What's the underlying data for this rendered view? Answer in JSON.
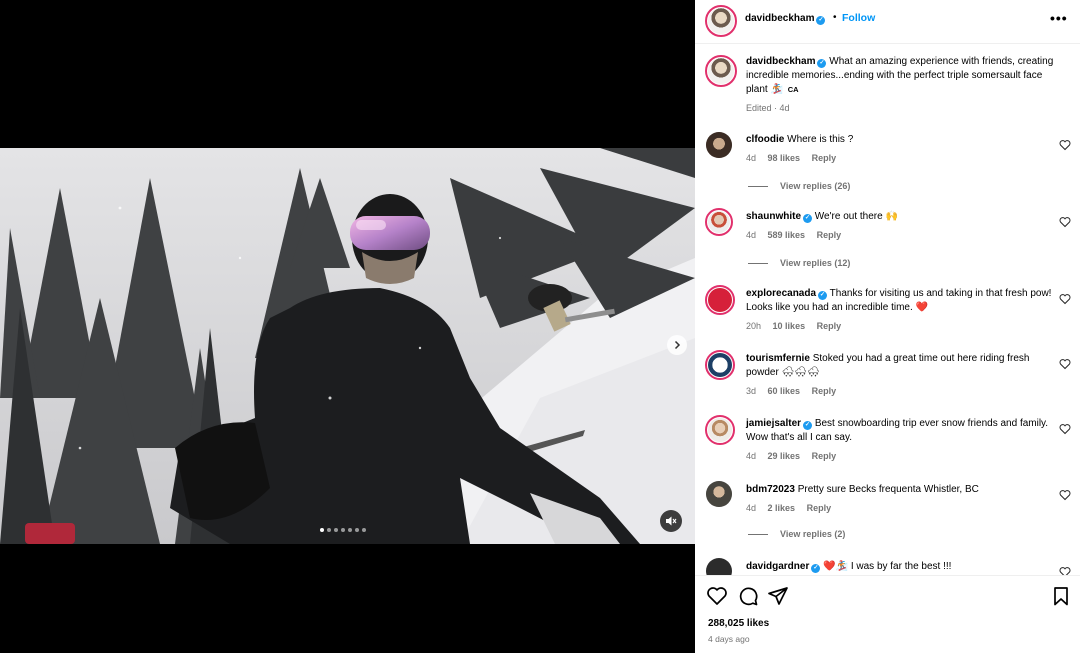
{
  "post": {
    "author": "davidbeckham",
    "follow_label": "Follow",
    "separator": "•",
    "more_label": "•••",
    "caption": "What an amazing experience with friends, creating incredible memories...ending with the perfect triple somersault face plant 🏂",
    "caption_tag": "CA",
    "edited_label": "Edited · 4d"
  },
  "media": {
    "carousel_count": 7,
    "active_index": 0
  },
  "comments": [
    {
      "user": "clfoodie",
      "verified": false,
      "text": "Where is this ?",
      "age": "4d",
      "likes": "98 likes",
      "reply": "Reply",
      "view_replies": "View replies (26)"
    },
    {
      "user": "shaunwhite",
      "verified": true,
      "text": "We're out there 🙌",
      "age": "4d",
      "likes": "589 likes",
      "reply": "Reply",
      "view_replies": "View replies (12)"
    },
    {
      "user": "explorecanada",
      "verified": true,
      "text": "Thanks for visiting us and taking in that fresh pow! Looks like you had an incredible time. ❤️",
      "age": "20h",
      "likes": "10 likes",
      "reply": "Reply"
    },
    {
      "user": "tourismfernie",
      "verified": false,
      "text": "Stoked you had a great time out here riding fresh powder 🌨🌨🌨",
      "age": "3d",
      "likes": "60 likes",
      "reply": "Reply"
    },
    {
      "user": "jamiejsalter",
      "verified": true,
      "text": "Best snowboarding trip ever snow friends and family. Wow that's all I can say.",
      "age": "4d",
      "likes": "29 likes",
      "reply": "Reply"
    },
    {
      "user": "bdm72023",
      "verified": false,
      "text": "Pretty sure Becks frequenta Whistler, BC",
      "age": "4d",
      "likes": "2 likes",
      "reply": "Reply",
      "view_replies": "View replies (2)"
    },
    {
      "user": "davidgardner",
      "verified": true,
      "text": "❤️🏂 I was by far the best !!!",
      "age": "",
      "likes": "",
      "reply": ""
    }
  ],
  "stats": {
    "likes": "288,025 likes",
    "posted": "4 days ago"
  },
  "colors": {
    "link_blue": "#0095f6",
    "verified_blue": "#1d9bf0",
    "muted_text": "#737373",
    "story_ring": "#e1306c"
  },
  "icons": [
    "heart-icon",
    "comment-icon",
    "share-icon",
    "bookmark-icon",
    "chevron-right-icon",
    "mute-icon",
    "more-icon"
  ]
}
